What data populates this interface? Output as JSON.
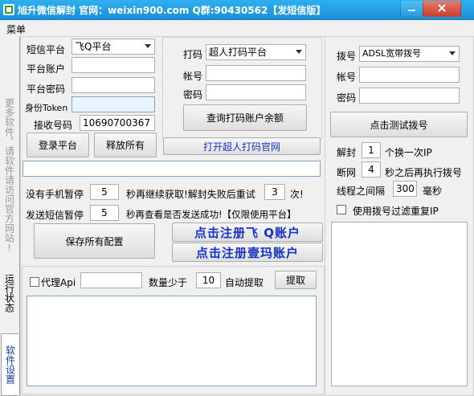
{
  "title": "旭升微信解封 官网：weixin900.com Q群:90430562【发短信版】",
  "menu": {
    "label": "菜单"
  },
  "tabs": [
    {
      "label": "更多软件，请软件请访问官方网站!"
    },
    {
      "label": "运行状态"
    },
    {
      "label": "软件设置"
    }
  ],
  "sms": {
    "platform_label": "短信平台",
    "platform_value": "飞Q平台",
    "account_label": "平台账户",
    "account_value": "",
    "password_label": "平台密码",
    "password_value": "",
    "token_label": "身份Token",
    "token_value": "",
    "recv_label": "接收号码",
    "recv_value": "10690700367",
    "login_button": "登录平台",
    "release_button": "释放所有"
  },
  "captcha": {
    "label": "打码",
    "platform_value": "超人打码平台",
    "account_label": "帐号",
    "account_value": "",
    "password_label": "密码",
    "password_value": "",
    "query_button": "查询打码账户余额",
    "open_site_button": "打开超人打码官网"
  },
  "dial": {
    "label": "拨号",
    "mode_value": "ADSL宽带拨号",
    "account_label": "帐号",
    "account_value": "",
    "password_label": "密码",
    "password_value": "",
    "test_button": "点击测试拨号",
    "unseal_label": "解封",
    "unseal_value": "1",
    "unseal_suffix": "个换一次IP",
    "disconnect_label": "断网",
    "disconnect_value": "4",
    "disconnect_suffix": "秒之后再执行拨号",
    "thread_label": "线程之间隔",
    "thread_value": "300",
    "thread_suffix": "毫秒",
    "filter_label": "使用拨号过滤重复IP",
    "filter_checked": false
  },
  "settings": {
    "status_value": "",
    "nophone_label": "没有手机暂停",
    "nophone_value": "5",
    "nophone_mid": "秒再继续获取!解封失败后重试",
    "retry_value": "3",
    "retry_suffix": "次!",
    "sendsms_label": "发送短信暂停",
    "sendsms_value": "5",
    "sendsms_suffix": "秒再查看是否发送成功!【仅限使用平台】",
    "save_button": "保存所有配置",
    "register_feiq": "点击注册飞 Q账户",
    "register_yima": "点击注册壹玛账户"
  },
  "proxy": {
    "label": "代理Api",
    "value": "",
    "count_label": "数量少于",
    "count_value": "10",
    "auto_label": "自动提取",
    "extract_button": "提取",
    "checked": false
  },
  "colors": {
    "titlebar": "#1b8fd6",
    "link_blue": "#1633c6"
  }
}
